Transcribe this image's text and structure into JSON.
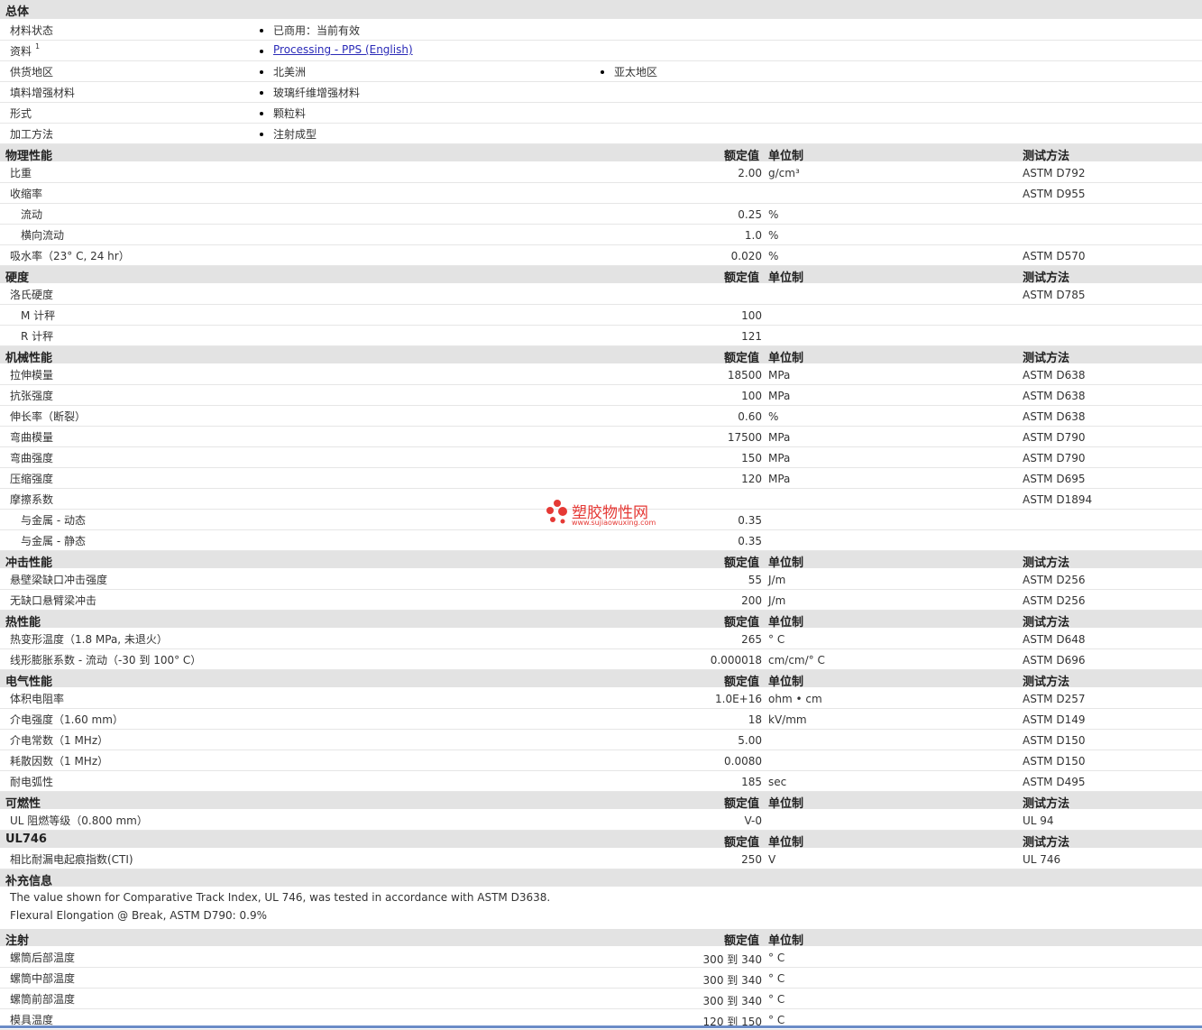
{
  "general": {
    "title": "总体",
    "rows": [
      {
        "label": "材料状态",
        "items": [
          "已商用：当前有效"
        ]
      },
      {
        "label": "资料",
        "sup": "1",
        "items": [
          "Processing - PPS (English)"
        ],
        "link": true
      },
      {
        "label": "供货地区",
        "items": [
          "北美洲",
          "亚太地区"
        ]
      },
      {
        "label": "填料增强材料",
        "items": [
          "玻璃纤维增强材料"
        ]
      },
      {
        "label": "形式",
        "items": [
          "颗粒料"
        ]
      },
      {
        "label": "加工方法",
        "items": [
          "注射成型"
        ]
      }
    ]
  },
  "headers": {
    "value": "额定值",
    "unit": "单位制",
    "test": "测试方法"
  },
  "sections": [
    {
      "title": "物理性能",
      "rows": [
        {
          "name": "比重",
          "value": "2.00",
          "unit": "g/cm³",
          "test": "ASTM D792"
        },
        {
          "name": "收缩率",
          "value": "",
          "unit": "",
          "test": "ASTM D955"
        },
        {
          "name": "流动",
          "sub": true,
          "value": "0.25",
          "unit": "%",
          "test": ""
        },
        {
          "name": "横向流动",
          "sub": true,
          "value": "1.0",
          "unit": "%",
          "test": ""
        },
        {
          "name": "吸水率（23° C, 24 hr）",
          "value": "0.020",
          "unit": "%",
          "test": "ASTM D570"
        }
      ]
    },
    {
      "title": "硬度",
      "rows": [
        {
          "name": "洛氏硬度",
          "value": "",
          "unit": "",
          "test": "ASTM D785"
        },
        {
          "name": "M 计秤",
          "sub": true,
          "value": "100",
          "unit": "",
          "test": ""
        },
        {
          "name": "R 计秤",
          "sub": true,
          "value": "121",
          "unit": "",
          "test": ""
        }
      ]
    },
    {
      "title": "机械性能",
      "rows": [
        {
          "name": "拉伸模量",
          "value": "18500",
          "unit": "MPa",
          "test": "ASTM D638"
        },
        {
          "name": "抗张强度",
          "value": "100",
          "unit": "MPa",
          "test": "ASTM D638"
        },
        {
          "name": "伸长率（断裂）",
          "value": "0.60",
          "unit": "%",
          "test": "ASTM D638"
        },
        {
          "name": "弯曲模量",
          "value": "17500",
          "unit": "MPa",
          "test": "ASTM D790"
        },
        {
          "name": "弯曲强度",
          "value": "150",
          "unit": "MPa",
          "test": "ASTM D790"
        },
        {
          "name": "压缩强度",
          "value": "120",
          "unit": "MPa",
          "test": "ASTM D695"
        },
        {
          "name": "摩擦系数",
          "value": "",
          "unit": "",
          "test": "ASTM D1894"
        },
        {
          "name": "与金属 - 动态",
          "sub": true,
          "value": "0.35",
          "unit": "",
          "test": ""
        },
        {
          "name": "与金属 - 静态",
          "sub": true,
          "value": "0.35",
          "unit": "",
          "test": ""
        }
      ]
    },
    {
      "title": "冲击性能",
      "rows": [
        {
          "name": "悬壁梁缺口冲击强度",
          "value": "55",
          "unit": "J/m",
          "test": "ASTM D256"
        },
        {
          "name": "无缺口悬臂梁冲击",
          "value": "200",
          "unit": "J/m",
          "test": "ASTM D256"
        }
      ]
    },
    {
      "title": "热性能",
      "rows": [
        {
          "name": "热变形温度（1.8 MPa, 未退火）",
          "value": "265",
          "unit": "° C",
          "test": "ASTM D648"
        },
        {
          "name": "线形膨胀系数 - 流动（-30 到 100° C）",
          "value": "0.000018",
          "unit": "cm/cm/° C",
          "test": "ASTM D696"
        }
      ]
    },
    {
      "title": "电气性能",
      "rows": [
        {
          "name": "体积电阻率",
          "value": "1.0E+16",
          "unit": "ohm • cm",
          "test": "ASTM D257"
        },
        {
          "name": "介电强度（1.60 mm）",
          "value": "18",
          "unit": "kV/mm",
          "test": "ASTM D149"
        },
        {
          "name": "介电常数（1 MHz）",
          "value": "5.00",
          "unit": "",
          "test": "ASTM D150"
        },
        {
          "name": "耗散因数（1 MHz）",
          "value": "0.0080",
          "unit": "",
          "test": "ASTM D150"
        },
        {
          "name": "耐电弧性",
          "value": "185",
          "unit": "sec",
          "test": "ASTM D495"
        }
      ]
    },
    {
      "title": "可燃性",
      "rows": [
        {
          "name": "UL 阻燃等级（0.800 mm）",
          "value": "V-0",
          "unit": "",
          "test": "UL 94"
        }
      ]
    },
    {
      "title": "UL746",
      "rows": [
        {
          "name": "相比耐漏电起痕指数(CTI)",
          "value": "250",
          "unit": "V",
          "test": "UL 746"
        }
      ]
    }
  ],
  "supplement": {
    "title": "补充信息",
    "notes": [
      "The value shown for Comparative Track Index, UL 746, was tested in accordance with ASTM D3638.",
      "Flexural Elongation @ Break, ASTM D790: 0.9%"
    ]
  },
  "injection": {
    "title": "注射",
    "rows": [
      {
        "name": "螺筒后部温度",
        "value": "300 到 340",
        "unit": "° C"
      },
      {
        "name": "螺筒中部温度",
        "value": "300 到 340",
        "unit": "° C"
      },
      {
        "name": "螺筒前部温度",
        "value": "300 到 340",
        "unit": "° C"
      },
      {
        "name": "模具温度",
        "value": "120 到 150",
        "unit": "° C"
      }
    ]
  },
  "watermark": {
    "text": "塑胶物性网",
    "url": "www.sujiaowuxing.com"
  },
  "colors": {
    "section_bg": "#e3e3e3",
    "link": "#2b2bb8",
    "logo": "#e53935"
  }
}
